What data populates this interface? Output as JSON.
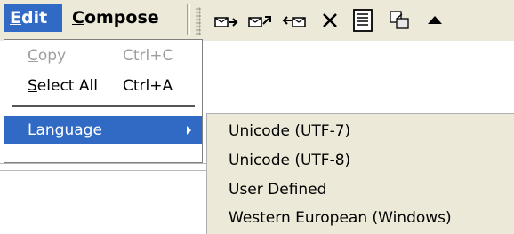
{
  "menubar": {
    "edit": {
      "label_u": "E",
      "label_rest": "dit"
    },
    "compose": {
      "label_u": "C",
      "label_rest": "ompose"
    }
  },
  "toolbar": {
    "buttons": [
      {
        "icon": "mail-forward-icon"
      },
      {
        "icon": "mail-reply-icon"
      },
      {
        "icon": "mail-reply-all-icon"
      },
      {
        "icon": "delete-icon"
      },
      {
        "icon": "message-list-icon"
      },
      {
        "icon": "copy-to-folder-icon"
      },
      {
        "icon": "arrow-up-icon"
      }
    ]
  },
  "edit_menu": {
    "copy": {
      "label_u": "C",
      "label_rest": "opy",
      "shortcut": "Ctrl+C"
    },
    "select_all": {
      "label_u": "S",
      "label_rest": "elect All",
      "shortcut": "Ctrl+A"
    },
    "language": {
      "label_u": "L",
      "label_rest": "anguage"
    }
  },
  "language_menu": {
    "items": [
      "Unicode (UTF-7)",
      "Unicode (UTF-8)",
      "User Defined",
      "Western European (Windows)"
    ]
  },
  "colors": {
    "menubar_bg": "#ece9d8",
    "highlight": "#316ac5",
    "disabled_text": "#9e9e9e"
  }
}
